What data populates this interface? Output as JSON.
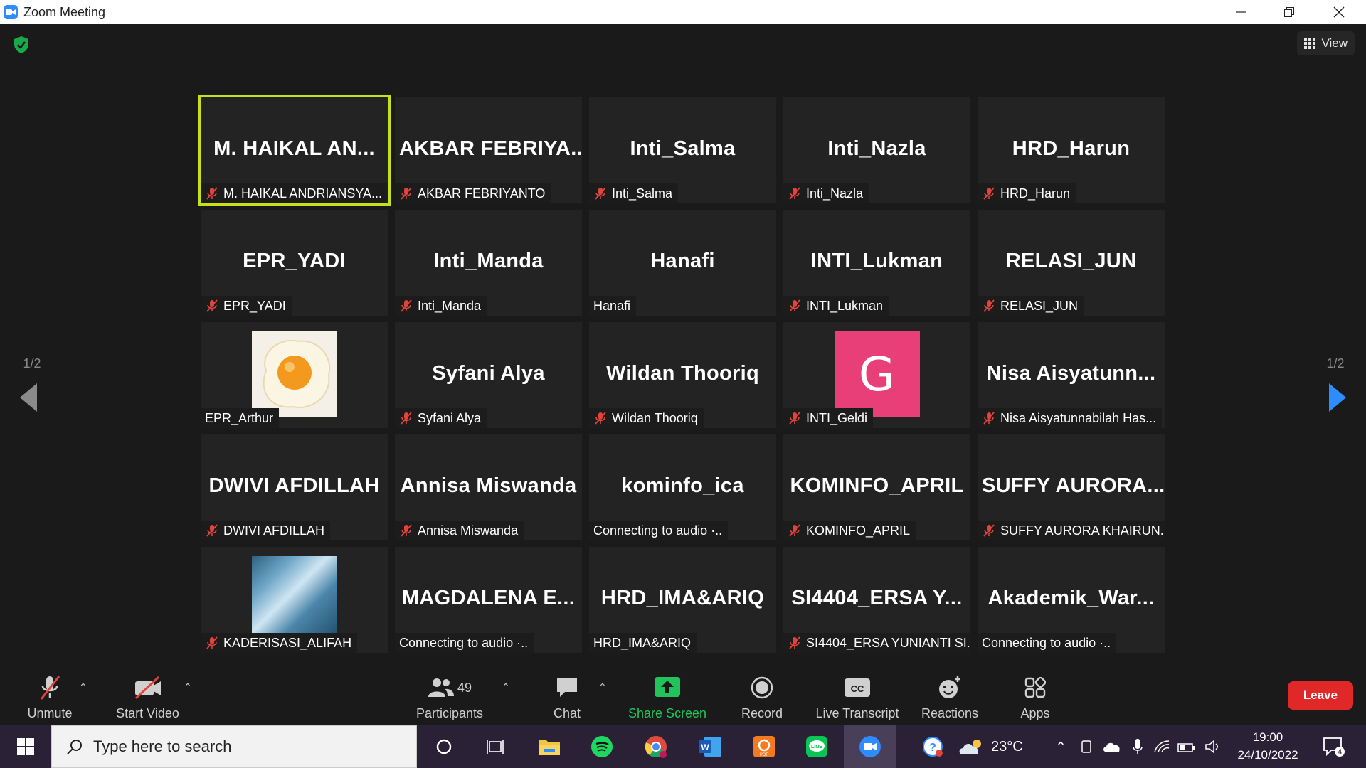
{
  "window": {
    "title": "Zoom Meeting"
  },
  "view_button": {
    "label": "View"
  },
  "pager": {
    "left": "1/2",
    "right": "1/2"
  },
  "tiles": [
    {
      "big": "M. HAIKAL AN...",
      "label": "M. HAIKAL ANDRIANSYA...",
      "muted": true,
      "active": true
    },
    {
      "big": "AKBAR FEBRIYA...",
      "label": "AKBAR FEBRIYANTO",
      "muted": true
    },
    {
      "big": "Inti_Salma",
      "label": "Inti_Salma",
      "muted": true
    },
    {
      "big": "Inti_Nazla",
      "label": "Inti_Nazla",
      "muted": true
    },
    {
      "big": "HRD_Harun",
      "label": "HRD_Harun",
      "muted": true
    },
    {
      "big": "EPR_YADI",
      "label": "EPR_YADI",
      "muted": true
    },
    {
      "big": "Inti_Manda",
      "label": "Inti_Manda",
      "muted": true
    },
    {
      "big": "Hanafi",
      "label": "Hanafi",
      "muted": false
    },
    {
      "big": "INTI_Lukman",
      "label": "INTI_Lukman",
      "muted": true
    },
    {
      "big": "RELASI_JUN",
      "label": "RELASI_JUN",
      "muted": true
    },
    {
      "big": "",
      "label": "EPR_Arthur",
      "muted": false,
      "avatar": "egg"
    },
    {
      "big": "Syfani Alya",
      "label": "Syfani Alya",
      "muted": true
    },
    {
      "big": "Wildan Thooriq",
      "label": "Wildan Thooriq",
      "muted": true
    },
    {
      "big": "",
      "label": "INTI_Geldi",
      "muted": true,
      "avatar": "g",
      "avatar_letter": "G"
    },
    {
      "big": "Nisa Aisyatunn...",
      "label": "Nisa Aisyatunnabilah Has...",
      "muted": true
    },
    {
      "big": "DWIVI AFDILLAH",
      "label": "DWIVI AFDILLAH",
      "muted": true
    },
    {
      "big": "Annisa Miswanda",
      "label": "Annisa Miswanda",
      "muted": true
    },
    {
      "big": "kominfo_ica",
      "label": "Connecting to audio ·..",
      "muted": false
    },
    {
      "big": "KOMINFO_APRIL",
      "label": "KOMINFO_APRIL",
      "muted": true
    },
    {
      "big": "SUFFY AURORA...",
      "label": "SUFFY AURORA KHAIRUN...",
      "muted": true
    },
    {
      "big": "",
      "label": "KADERISASI_ALIFAH",
      "muted": true,
      "avatar": "ice"
    },
    {
      "big": "MAGDALENA E...",
      "label": "Connecting to audio ·..",
      "muted": false
    },
    {
      "big": "HRD_IMA&ARIQ",
      "label": "HRD_IMA&ARIQ",
      "muted": false
    },
    {
      "big": "SI4404_ERSA Y...",
      "label": "SI4404_ERSA YUNIANTI SI...",
      "muted": true
    },
    {
      "big": "Akademik_War...",
      "label": "Connecting to audio ·..",
      "muted": false
    }
  ],
  "toolbar": {
    "unmute": "Unmute",
    "start_video": "Start Video",
    "participants": "Participants",
    "participants_count": "49",
    "chat": "Chat",
    "share_screen": "Share Screen",
    "record": "Record",
    "live_transcript": "Live Transcript",
    "reactions": "Reactions",
    "apps": "Apps",
    "leave": "Leave"
  },
  "taskbar": {
    "search_placeholder": "Type here to search",
    "temperature": "23°C",
    "time": "19:00",
    "date": "24/10/2022",
    "notification_count": "4"
  },
  "colors": {
    "active_speaker": "#c6e01c",
    "share_green": "#22c35b",
    "leave_red": "#e02828",
    "muted_red": "#e0443c",
    "zoom_blue": "#2d8cff"
  }
}
